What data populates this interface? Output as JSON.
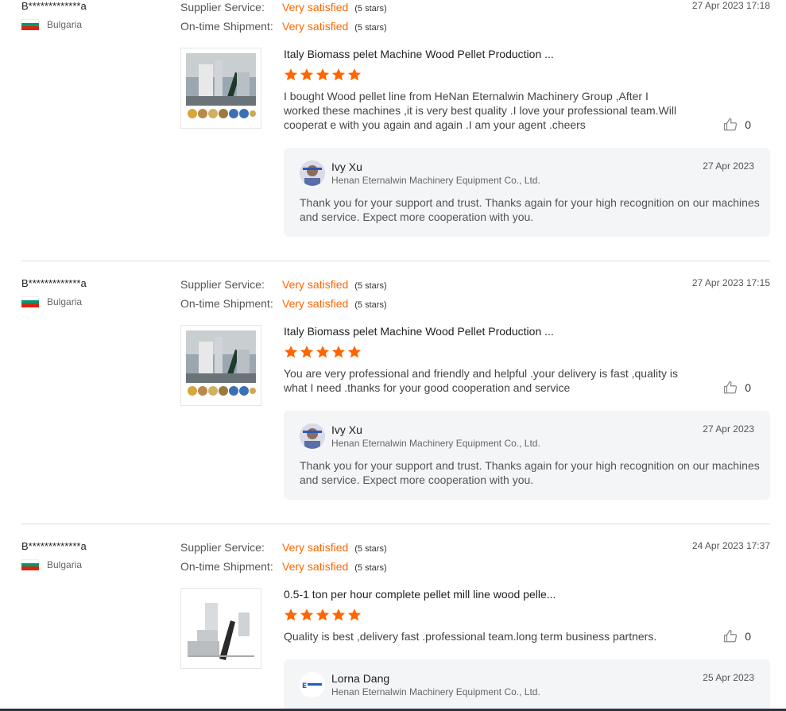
{
  "colors": {
    "accent": "#ff6600",
    "reply_bg": "#f4f5f7",
    "flag_white": "#ffffff",
    "flag_green": "#00966e",
    "flag_red": "#d62612"
  },
  "labels": {
    "supplier_service": "Supplier Service:",
    "on_time_shipment": "On-time Shipment:"
  },
  "reviews": [
    {
      "buyer": "B*************a",
      "country": "Bulgaria",
      "date": "27 Apr 2023 17:18",
      "supplier_service": {
        "value": "Very satisfied",
        "stars": "(5 stars)"
      },
      "shipment": {
        "value": "Very satisfied",
        "stars": "(5 stars)"
      },
      "product_title": "Italy Biomass pelet Machine Wood Pellet Production ...",
      "rating": 5,
      "text": "I bought Wood pellet line from HeNan Eternalwin Machinery Group ,After I worked these machines ,it is very best quality .I love your professional team.Will cooperat e with you again and again .I am your agent .cheers",
      "likes": "0",
      "reply": {
        "name": "Ivy Xu",
        "company": "Henan Eternalwin Machinery Equipment Co., Ltd.",
        "date": "27 Apr 2023",
        "text": "Thank you for your support and trust. Thanks again for your high recognition on our machines and service. Expect more cooperation with you."
      }
    },
    {
      "buyer": "B*************a",
      "country": "Bulgaria",
      "date": "27 Apr 2023 17:15",
      "supplier_service": {
        "value": "Very satisfied",
        "stars": "(5 stars)"
      },
      "shipment": {
        "value": "Very satisfied",
        "stars": "(5 stars)"
      },
      "product_title": "Italy Biomass pelet Machine Wood Pellet Production ...",
      "rating": 5,
      "text": "You are very professional and friendly and helpful .your delivery is fast ,quality is what I need .thanks for your good cooperation and service",
      "likes": "0",
      "reply": {
        "name": "Ivy Xu",
        "company": "Henan Eternalwin Machinery Equipment Co., Ltd.",
        "date": "27 Apr 2023",
        "text": "Thank you for your support and trust. Thanks again for your high recognition on our machines and service. Expect more cooperation with you."
      }
    },
    {
      "buyer": "B*************a",
      "country": "Bulgaria",
      "date": "24 Apr 2023 17:37",
      "supplier_service": {
        "value": "Very satisfied",
        "stars": "(5 stars)"
      },
      "shipment": {
        "value": "Very satisfied",
        "stars": "(5 stars)"
      },
      "product_title": "0.5-1 ton per hour complete pellet mill line wood pelle...",
      "rating": 5,
      "text": "Quality is best ,delivery fast .professional team.long term business partners.",
      "likes": "0",
      "reply": {
        "name": "Lorna Dang",
        "company": "Henan Eternalwin Machinery Equipment Co., Ltd.",
        "date": "25 Apr 2023",
        "text": ""
      }
    }
  ]
}
